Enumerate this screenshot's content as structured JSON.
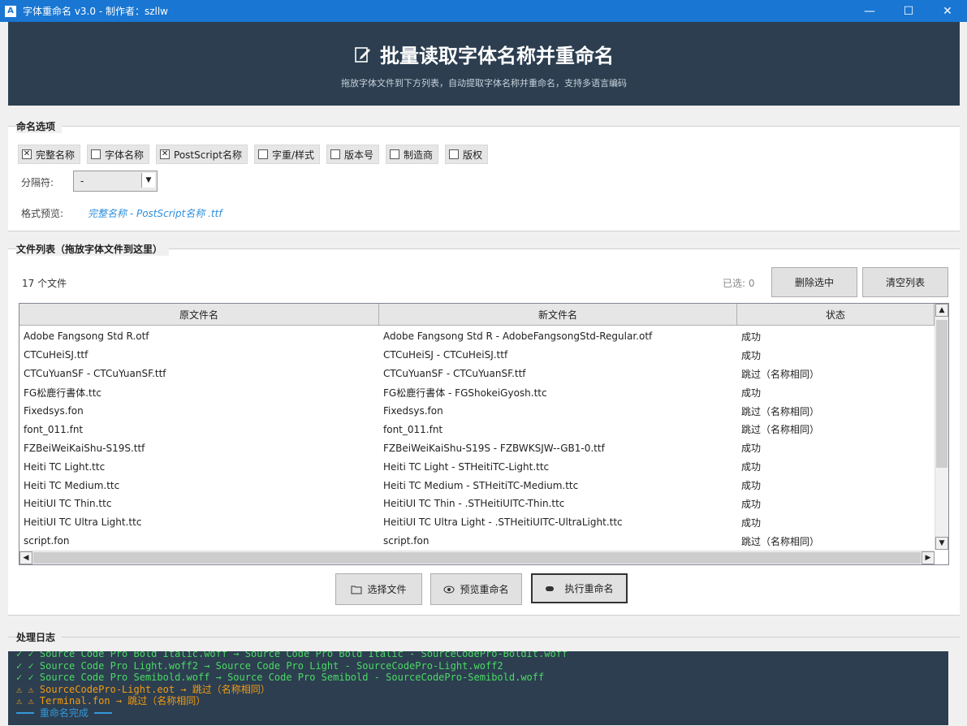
{
  "window": {
    "title": "字体重命名 v3.0 - 制作者：szllw",
    "app_icon": "A",
    "minimize": "—",
    "maximize": "☐",
    "close": "✕"
  },
  "header": {
    "title": "批量读取字体名称并重命名",
    "subtitle": "拖放字体文件到下方列表，自动提取字体名称并重命名，支持多语言编码",
    "icon": "edit-icon"
  },
  "naming_options": {
    "legend": "命名选项",
    "options": [
      {
        "label": "完整名称",
        "checked": true
      },
      {
        "label": "字体名称",
        "checked": false
      },
      {
        "label": "PostScript名称",
        "checked": true
      },
      {
        "label": "字重/样式",
        "checked": false
      },
      {
        "label": "版本号",
        "checked": false
      },
      {
        "label": "制造商",
        "checked": false
      },
      {
        "label": "版权",
        "checked": false
      }
    ],
    "check_mark": "✕",
    "separator_label": "分隔符:",
    "separator_value": "-",
    "preview_label": "格式预览:",
    "preview_value": "完整名称 - PostScript名称 .ttf"
  },
  "file_list": {
    "legend": "文件列表（拖放字体文件到这里）",
    "count": "17 个文件",
    "selected": "已选: 0",
    "delete_selected": "删除选中",
    "clear_list": "清空列表",
    "columns": [
      "原文件名",
      "新文件名",
      "状态"
    ],
    "rows": [
      [
        "Adobe Fangsong Std R.otf",
        "Adobe Fangsong Std R - AdobeFangsongStd-Regular.otf",
        "成功"
      ],
      [
        "CTCuHeiSJ.ttf",
        "CTCuHeiSJ - CTCuHeiSJ.ttf",
        "成功"
      ],
      [
        "CTCuYuanSF - CTCuYuanSF.ttf",
        "CTCuYuanSF - CTCuYuanSF.ttf",
        "跳过（名称相同）"
      ],
      [
        "FG松鹿行書体.ttc",
        "FG松鹿行書体 - FGShokeiGyosh.ttc",
        "成功"
      ],
      [
        "Fixedsys.fon",
        "Fixedsys.fon",
        "跳过（名称相同）"
      ],
      [
        "font_011.fnt",
        "font_011.fnt",
        "跳过（名称相同）"
      ],
      [
        "FZBeiWeiKaiShu-S19S.ttf",
        "FZBeiWeiKaiShu-S19S - FZBWKSJW--GB1-0.ttf",
        "成功"
      ],
      [
        "Heiti TC Light.ttc",
        "Heiti TC Light - STHeitiTC-Light.ttc",
        "成功"
      ],
      [
        "Heiti TC Medium.ttc",
        "Heiti TC Medium - STHeitiTC-Medium.ttc",
        "成功"
      ],
      [
        "HeitiUI TC Thin.ttc",
        "HeitiUI TC Thin - .STHeitiUITC-Thin.ttc",
        "成功"
      ],
      [
        "HeitiUI TC Ultra Light.ttc",
        "HeitiUI TC Ultra Light - .STHeitiUITC-UltraLight.ttc",
        "成功"
      ],
      [
        "script.fon",
        "script.fon",
        "跳过（名称相同）"
      ]
    ]
  },
  "actions": {
    "select_files": "选择文件",
    "preview_rename": "预览重命名",
    "execute_rename": "执行重命名"
  },
  "log": {
    "legend": "处理日志",
    "lines": [
      {
        "text": "✓ ✓ Source Code Pro Bold Italic.woff → Source Code Pro Bold Italic - SourceCodePro-BoldIt.woff",
        "color": "#4cd964"
      },
      {
        "text": "✓ ✓ Source Code Pro Light.woff2 → Source Code Pro Light - SourceCodePro-Light.woff2",
        "color": "#4cd964"
      },
      {
        "text": "✓ ✓ Source Code Pro Semibold.woff → Source Code Pro Semibold - SourceCodePro-Semibold.woff",
        "color": "#4cd964"
      },
      {
        "text": "⚠ ⚠ SourceCodePro-Light.eot → 跳过（名称相同）",
        "color": "#f39c12"
      },
      {
        "text": "⚠ ⚠ Terminal.fon → 跳过（名称相同）",
        "color": "#f39c12"
      },
      {
        "text": "━━━ 重命名完成 ━━━",
        "color": "#3498db"
      }
    ]
  }
}
